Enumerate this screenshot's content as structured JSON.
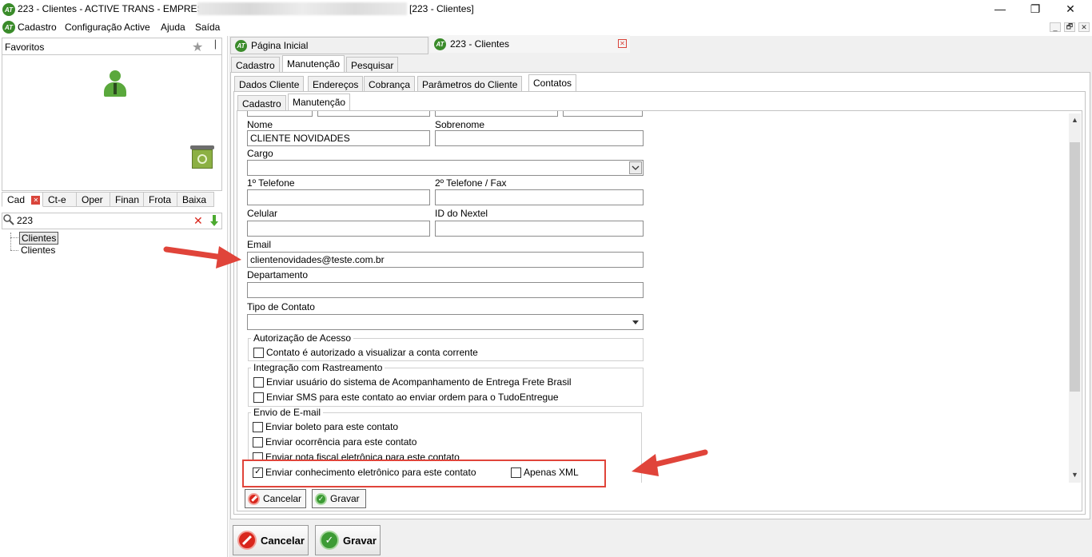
{
  "window": {
    "logo": "AT",
    "title": "223 - Clientes - ACTIVE TRANS - EMPRESA",
    "title_suffix": "[223 - Clientes]",
    "minimize": "—",
    "maximize": "❐",
    "close": "✕"
  },
  "menu": {
    "items": [
      "Cadastro",
      "Configuração Active",
      "Ajuda",
      "Saída"
    ],
    "mdi_buttons": [
      "_",
      "🗗",
      "✕"
    ]
  },
  "left": {
    "favorites_label": "Favoritos",
    "tabs": [
      "Cad",
      "Ct-e",
      "Oper",
      "Finan",
      "Frota",
      "Baixa"
    ],
    "search_value": "223",
    "tree_items": [
      "Clientes",
      "Clientes"
    ]
  },
  "doc_tabs": [
    {
      "label": "Página Inicial"
    },
    {
      "label": "223 - Clientes"
    }
  ],
  "tabs_level1": [
    "Cadastro",
    "Manutenção",
    "Pesquisar"
  ],
  "tabs_level2": [
    "Dados Cliente",
    "Endereços",
    "Cobrança",
    "Parâmetros do Cliente",
    "Contatos"
  ],
  "tabs_level3": [
    "Cadastro",
    "Manutenção"
  ],
  "form": {
    "nome_label": "Nome",
    "nome_value": "CLIENTE NOVIDADES",
    "sobrenome_label": "Sobrenome",
    "sobrenome_value": "",
    "cargo_label": "Cargo",
    "cargo_value": "",
    "tel1_label": "1º Telefone",
    "tel1_value": "",
    "tel2_label": "2º Telefone / Fax",
    "tel2_value": "",
    "celular_label": "Celular",
    "celular_value": "",
    "nextel_label": "ID do Nextel",
    "nextel_value": "",
    "email_label": "Email",
    "email_value": "clientenovidades@teste.com.br",
    "departamento_label": "Departamento",
    "departamento_value": "",
    "tipo_label": "Tipo de Contato",
    "tipo_value": ""
  },
  "groups": {
    "autorizacao": {
      "title": "Autorização de Acesso",
      "items": [
        {
          "label": "Contato é autorizado a visualizar a conta corrente",
          "checked": false
        }
      ]
    },
    "integracao": {
      "title": "Integração com Rastreamento",
      "items": [
        {
          "label": "Enviar usuário do sistema de Acompanhamento de Entrega Frete Brasil",
          "checked": false
        },
        {
          "label": "Enviar SMS para este contato ao enviar ordem para o TudoEntregue",
          "checked": false
        }
      ]
    },
    "envio": {
      "title": "Envio de E-mail",
      "items": [
        {
          "label": "Enviar boleto para este contato",
          "checked": false
        },
        {
          "label": "Enviar ocorrência para este contato",
          "checked": false
        },
        {
          "label": "Enviar nota fiscal eletrônica para este contato",
          "checked": false
        },
        {
          "label": "Enviar conhecimento eletrônico para este contato",
          "checked": true
        },
        {
          "label": "Apenas XML",
          "checked": false
        }
      ]
    }
  },
  "buttons": {
    "cancel_small": "Cancelar",
    "save_small": "Gravar",
    "cancel_big": "Cancelar",
    "save_big": "Gravar"
  },
  "colors": {
    "annotation": "#e0443a",
    "brand_green": "#3a8b2a"
  },
  "icons": {
    "check": "✓",
    "star": "★",
    "pin": "📌",
    "close_x": "✕",
    "search": "🔍",
    "down_arrow": "▼",
    "up_arrow": "▲"
  }
}
